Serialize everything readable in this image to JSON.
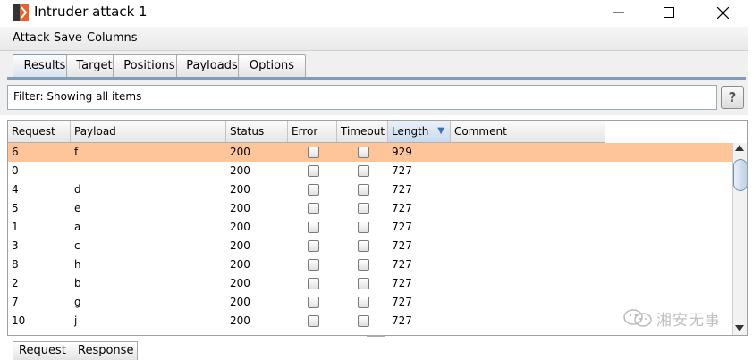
{
  "window": {
    "title": "Intruder attack 1"
  },
  "menu": [
    "Attack",
    "Save",
    "Columns"
  ],
  "tabs": [
    "Results",
    "Target",
    "Positions",
    "Payloads",
    "Options"
  ],
  "bottom_tabs": [
    "Request",
    "Response"
  ],
  "filter": {
    "text": "Filter: Showing all items",
    "help": "?"
  },
  "table": {
    "columns": [
      "Request",
      "Payload",
      "Status",
      "Error",
      "Timeout",
      "Length",
      "Comment"
    ],
    "sorted_column": "Length",
    "rows": [
      {
        "request": "6",
        "payload": "f",
        "status": "200",
        "error": false,
        "timeout": false,
        "length": "929",
        "comment": "",
        "selected": true
      },
      {
        "request": "0",
        "payload": "",
        "status": "200",
        "error": false,
        "timeout": false,
        "length": "727",
        "comment": ""
      },
      {
        "request": "4",
        "payload": "d",
        "status": "200",
        "error": false,
        "timeout": false,
        "length": "727",
        "comment": ""
      },
      {
        "request": "5",
        "payload": "e",
        "status": "200",
        "error": false,
        "timeout": false,
        "length": "727",
        "comment": ""
      },
      {
        "request": "1",
        "payload": "a",
        "status": "200",
        "error": false,
        "timeout": false,
        "length": "727",
        "comment": ""
      },
      {
        "request": "3",
        "payload": "c",
        "status": "200",
        "error": false,
        "timeout": false,
        "length": "727",
        "comment": ""
      },
      {
        "request": "8",
        "payload": "h",
        "status": "200",
        "error": false,
        "timeout": false,
        "length": "727",
        "comment": ""
      },
      {
        "request": "2",
        "payload": "b",
        "status": "200",
        "error": false,
        "timeout": false,
        "length": "727",
        "comment": ""
      },
      {
        "request": "7",
        "payload": "g",
        "status": "200",
        "error": false,
        "timeout": false,
        "length": "727",
        "comment": ""
      },
      {
        "request": "10",
        "payload": "j",
        "status": "200",
        "error": false,
        "timeout": false,
        "length": "727",
        "comment": ""
      }
    ]
  },
  "watermark": {
    "text": "湘安无事"
  },
  "colors": {
    "selected_row": "#ffc59a",
    "tab_accent": "#7f9db9",
    "logo": "#e8612c"
  },
  "icons": {
    "app": "burp-logo-icon",
    "minimize": "minimize-icon",
    "maximize": "maximize-icon",
    "close": "close-icon",
    "help": "help-icon",
    "wechat": "wechat-icon"
  }
}
